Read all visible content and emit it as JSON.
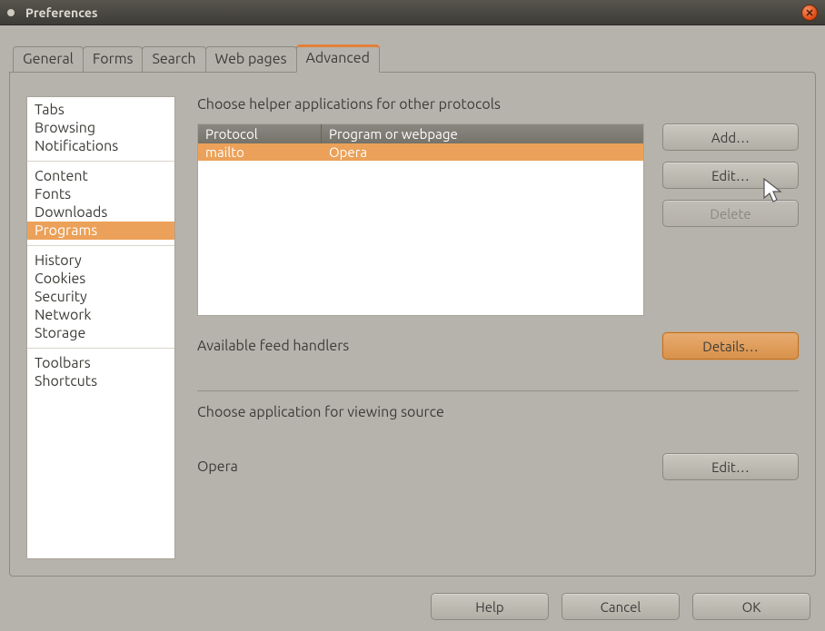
{
  "window": {
    "title": "Preferences"
  },
  "tabs": [
    {
      "label": "General"
    },
    {
      "label": "Forms"
    },
    {
      "label": "Search"
    },
    {
      "label": "Web pages"
    },
    {
      "label": "Advanced",
      "active": true
    }
  ],
  "sidebar": {
    "groups": [
      [
        "Tabs",
        "Browsing",
        "Notifications"
      ],
      [
        "Content",
        "Fonts",
        "Downloads",
        "Programs"
      ],
      [
        "History",
        "Cookies",
        "Security",
        "Network",
        "Storage"
      ],
      [
        "Toolbars",
        "Shortcuts"
      ]
    ],
    "selected": "Programs"
  },
  "programs": {
    "heading": "Choose helper applications for other protocols",
    "columns": {
      "protocol": "Protocol",
      "program": "Program or webpage"
    },
    "rows": [
      {
        "protocol": "mailto",
        "program": "Opera",
        "selected": true
      }
    ],
    "buttons": {
      "add": "Add…",
      "edit": "Edit…",
      "delete": "Delete"
    }
  },
  "feeds": {
    "heading": "Available feed handlers",
    "details": "Details…"
  },
  "viewSource": {
    "heading": "Choose application for viewing source",
    "app": "Opera",
    "edit": "Edit…"
  },
  "footer": {
    "help": "Help",
    "cancel": "Cancel",
    "ok": "OK"
  }
}
